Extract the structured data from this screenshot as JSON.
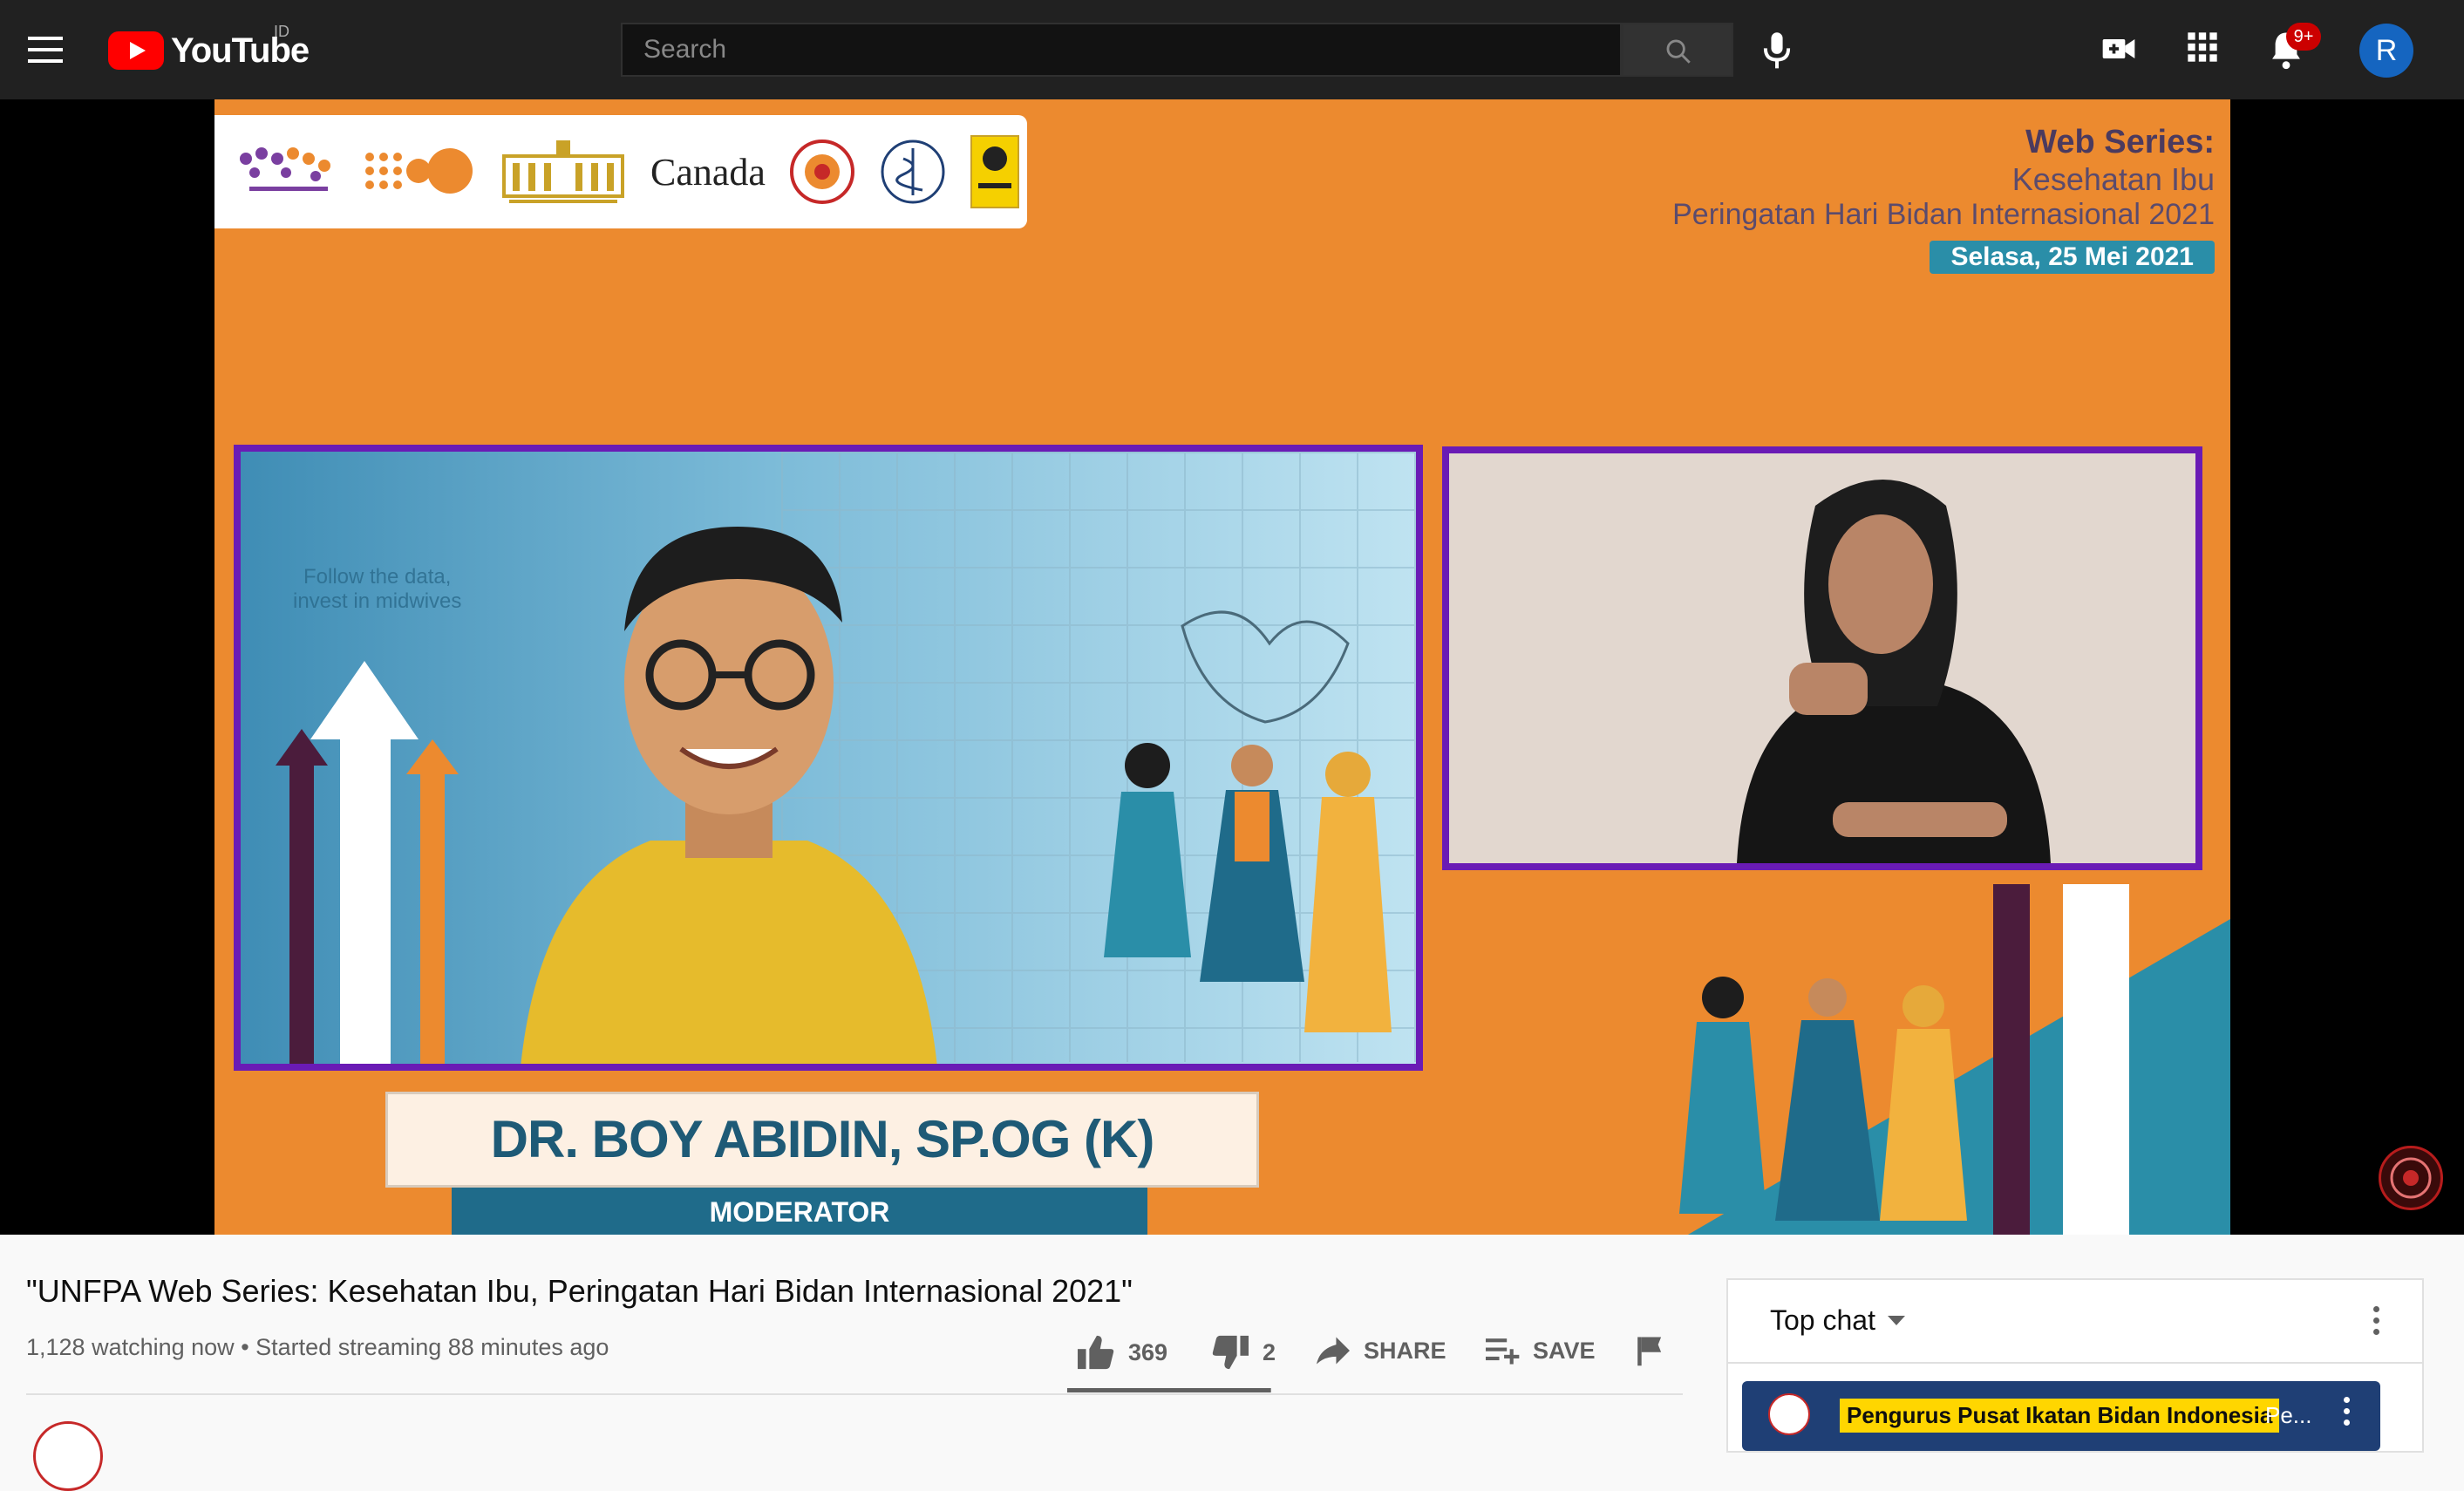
{
  "topbar": {
    "logo_text": "YouTube",
    "country_code": "ID",
    "search_placeholder": "Search",
    "notification_count": "9+",
    "avatar_letter": "R",
    "icons": [
      "menu-icon",
      "youtube-logo-icon",
      "search-icon",
      "mic-icon",
      "create-video-icon",
      "apps-grid-icon",
      "bell-icon"
    ]
  },
  "video_frame": {
    "logo_strip": {
      "canada_word": "Canada",
      "logos": [
        "knowledge-hub-logo",
        "unfpa-logo",
        "kantor-staf-presiden-logo",
        "canada-logo",
        "ibi-logo",
        "caduceus-logo",
        "university-logo"
      ]
    },
    "series_title": "Web Series:",
    "series_subtitle": "Kesehatan Ibu",
    "event_name": "Peringatan Hari Bidan Internasional 2021",
    "date": "Selasa, 25 Mei 2021",
    "slogan_line1": "Follow the data,",
    "slogan_line2": "invest in midwives",
    "speaker_name": "DR. BOY ABIDIN, SP.OG (K)",
    "speaker_role": "MODERATOR"
  },
  "video_info": {
    "title": "\"UNFPA Web Series: Kesehatan Ibu, Peringatan Hari Bidan Internasional 2021\"",
    "watching": "1,128 watching now",
    "separator": "•",
    "started": "Started streaming 88 minutes ago",
    "likes": "369",
    "dislikes": "2",
    "like_ratio": 0.995,
    "share_label": "SHARE",
    "save_label": "SAVE"
  },
  "chat": {
    "mode_label": "Top chat",
    "pinned_author": "Pengurus Pusat Ikatan Bidan Indonesia",
    "pinned_message": "Pe..."
  },
  "colors": {
    "brand_red": "#ff0000",
    "video_orange": "#ec8a2f",
    "frame_purple": "#6a1bb5",
    "accent_teal": "#2a8ea8",
    "pinned_blue": "#1f3f75",
    "author_highlight": "#ffd600"
  }
}
